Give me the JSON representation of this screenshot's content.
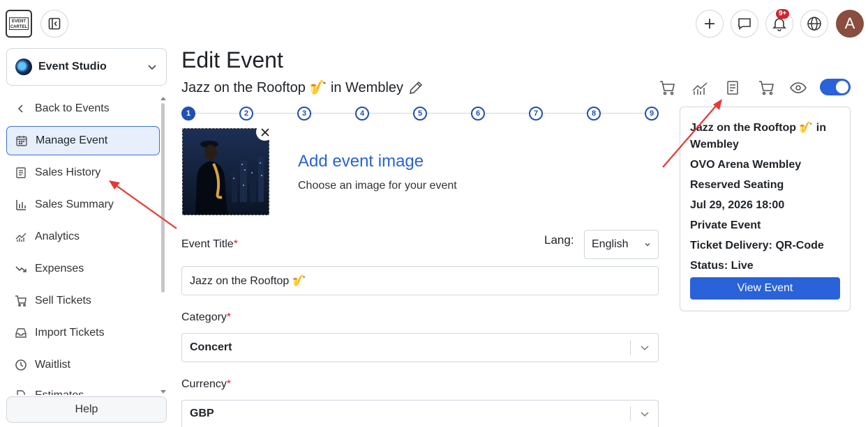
{
  "brand": {
    "logo_text": "EVENT CARTEL",
    "studio_name": "Event Studio"
  },
  "topbar": {
    "notification_count": "9+",
    "avatar_initial": "A"
  },
  "sidebar": {
    "items": [
      {
        "label": "Back to Events",
        "icon": "chevron-left-icon"
      },
      {
        "label": "Manage Event",
        "icon": "calendar-icon",
        "active": true
      },
      {
        "label": "Sales History",
        "icon": "receipt-icon"
      },
      {
        "label": "Sales Summary",
        "icon": "bar-chart-icon"
      },
      {
        "label": "Analytics",
        "icon": "analytics-icon"
      },
      {
        "label": "Expenses",
        "icon": "trend-down-icon"
      },
      {
        "label": "Sell Tickets",
        "icon": "cart-icon"
      },
      {
        "label": "Import Tickets",
        "icon": "inbox-icon"
      },
      {
        "label": "Waitlist",
        "icon": "clock-icon"
      },
      {
        "label": "Estimates",
        "icon": "document-icon"
      }
    ],
    "help_label": "Help"
  },
  "main": {
    "page_title": "Edit Event",
    "event_name": "Jazz on the Rooftop 🎷 in Wembley",
    "steps": [
      "1",
      "2",
      "3",
      "4",
      "5",
      "6",
      "7",
      "8",
      "9"
    ],
    "active_step": 1,
    "image": {
      "title": "Add event image",
      "subtitle": "Choose an image for your event"
    },
    "fields": {
      "title_label": "Event Title",
      "title_value": "Jazz on the Rooftop 🎷",
      "lang_label": "Lang:",
      "lang_value": "English",
      "category_label": "Category",
      "category_value": "Concert",
      "currency_label": "Currency",
      "currency_value": "GBP",
      "required_mark": "*"
    }
  },
  "summary": {
    "lines": [
      "Jazz on the Rooftop 🎷 in Wembley",
      "OVO Arena Wembley",
      "Reserved Seating",
      "Jul 29, 2026 18:00",
      "Private Event",
      "Ticket Delivery: QR-Code",
      "Status: Live"
    ],
    "view_button": "View Event",
    "toolbar_icons": [
      "cart-icon",
      "analytics-icon",
      "receipt-icon",
      "cart-icon",
      "eye-icon"
    ],
    "live_toggle_on": true
  },
  "colors": {
    "accent": "#2962d9",
    "annotation_arrow": "#e53935",
    "required": "#d1242f"
  }
}
